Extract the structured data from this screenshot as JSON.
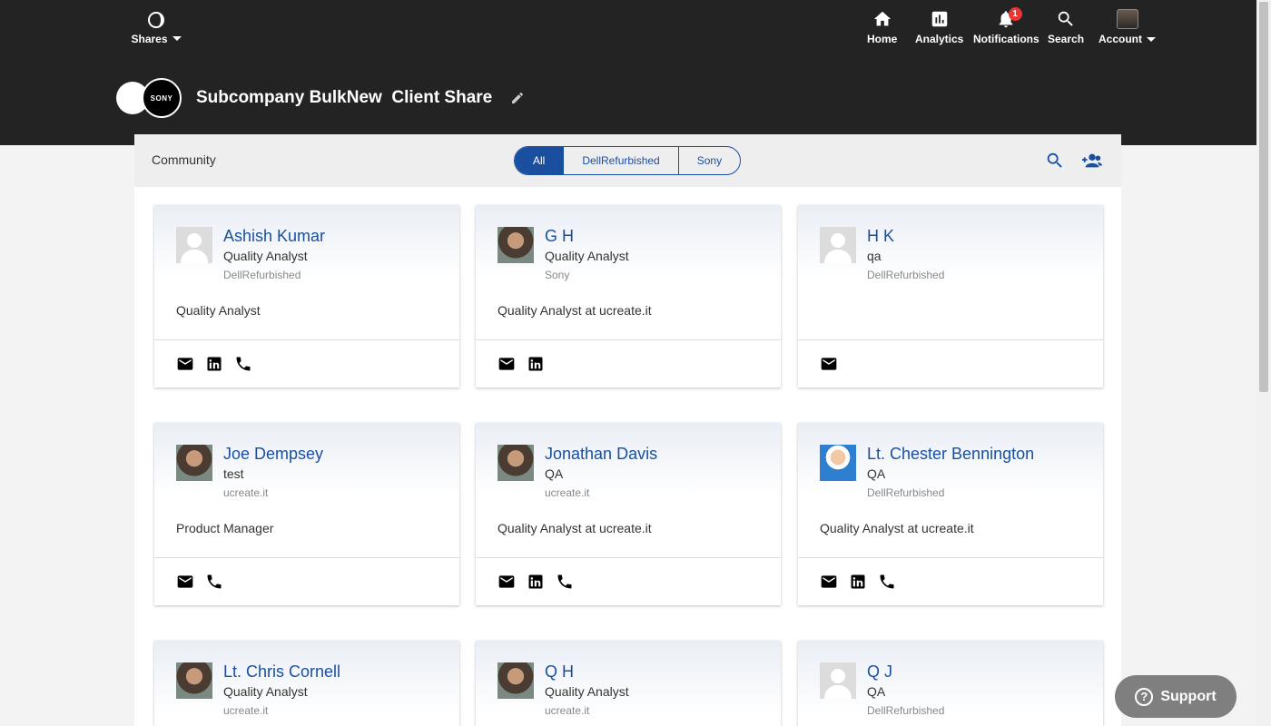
{
  "header": {
    "shares_label": "Shares",
    "nav": {
      "home": "Home",
      "analytics": "Analytics",
      "notifications": "Notifications",
      "notifications_count": "1",
      "search": "Search",
      "account": "Account"
    }
  },
  "share": {
    "logo_text": "SONY",
    "title": "Subcompany BulkNew  Client Share"
  },
  "community": {
    "label": "Community",
    "filters": [
      "All",
      "DellRefurbished",
      "Sony"
    ],
    "active_filter": "All"
  },
  "cards": [
    {
      "name": "Ashish Kumar",
      "role": "Quality Analyst",
      "org": "DellRefurbished",
      "desc": "Quality Analyst",
      "avatar": "default",
      "contacts": [
        "mail-icon",
        "linkedin-icon",
        "phone-icon"
      ]
    },
    {
      "name": "G H",
      "role": "Quality Analyst",
      "org": "Sony",
      "desc": "Quality Analyst at ucreate.it",
      "avatar": "photo",
      "contacts": [
        "mail-icon",
        "linkedin-icon"
      ]
    },
    {
      "name": "H K",
      "role": "qa",
      "org": "DellRefurbished",
      "desc": "",
      "avatar": "default",
      "contacts": [
        "mail-icon"
      ]
    },
    {
      "name": "Joe Dempsey",
      "role": "test",
      "org": "ucreate.it",
      "desc": "Product Manager",
      "avatar": "photo",
      "contacts": [
        "mail-icon",
        "phone-icon"
      ]
    },
    {
      "name": "Jonathan Davis",
      "role": "QA",
      "org": "ucreate.it",
      "desc": "Quality Analyst at ucreate.it",
      "avatar": "photo",
      "contacts": [
        "mail-icon",
        "linkedin-icon",
        "phone-icon"
      ]
    },
    {
      "name": "Lt. Chester Bennington",
      "role": "QA",
      "org": "DellRefurbished",
      "desc": "Quality Analyst at ucreate.it",
      "avatar": "illustration",
      "contacts": [
        "mail-icon",
        "linkedin-icon",
        "phone-icon"
      ]
    },
    {
      "name": "Lt. Chris Cornell",
      "role": "Quality Analyst",
      "org": "ucreate.it",
      "desc": "",
      "avatar": "photo",
      "contacts": []
    },
    {
      "name": "Q H",
      "role": "Quality Analyst",
      "org": "ucreate.it",
      "desc": "",
      "avatar": "photo",
      "contacts": []
    },
    {
      "name": "Q J",
      "role": "QA",
      "org": "DellRefurbished",
      "desc": "",
      "avatar": "default",
      "contacts": []
    }
  ],
  "support_label": "Support",
  "colors": {
    "topbar": "#232323",
    "accent": "#1a4fa0",
    "badge": "#e33333"
  }
}
